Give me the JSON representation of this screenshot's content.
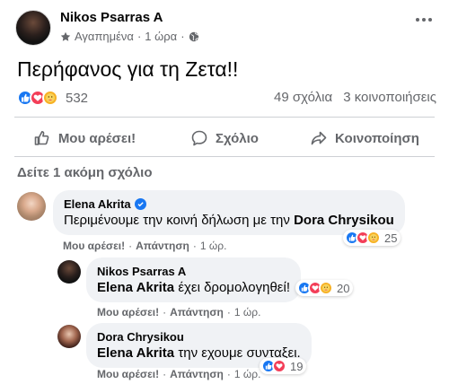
{
  "post": {
    "author": "Nikos Psarras A",
    "meta_favorites": "Αγαπημένα",
    "meta_separator": "·",
    "meta_time": "1 ώρα",
    "meta_separator2": "·",
    "text": "Περήφανος για τη Ζετα!!",
    "reaction_count": "532",
    "comments": "49 σχόλια",
    "shares": "3 κοινοποιήσεις"
  },
  "actions": {
    "like": "Μου αρέσει!",
    "comment": "Σχόλιο",
    "share": "Κοινοποίηση"
  },
  "more_comments": "Δείτε 1 ακόμη σχόλιο",
  "comments": [
    {
      "name": "Elena Akrita",
      "text_before": "Περιμένουμε την κοινή δήλωση με την ",
      "mention": "Dora Chrysikou",
      "text_after": "",
      "like_label": "Μου αρέσει!",
      "reply_label": "Απάντηση",
      "time": "1 ώρ.",
      "reaction_count": "25"
    },
    {
      "name": "Nikos Psarras A",
      "mention": "Elena Akrita",
      "text_after": " έχει δρομολογηθεί!",
      "like_label": "Μου αρέσει!",
      "reply_label": "Απάντηση",
      "time": "1 ώρ.",
      "reaction_count": "20"
    },
    {
      "name": "Dora Chrysikou",
      "mention": "Elena Akrita",
      "text_after": " την εχουμε συνταξει.",
      "like_label": "Μου αρέσει!",
      "reply_label": "Απάντηση",
      "time": "1 ώρ.",
      "reaction_count": "19"
    }
  ],
  "colors": {
    "like": "#1877f2",
    "love": "#f33e58",
    "care": "#f7b125",
    "secondary_text": "#65676b",
    "bubble": "#f0f2f5"
  }
}
